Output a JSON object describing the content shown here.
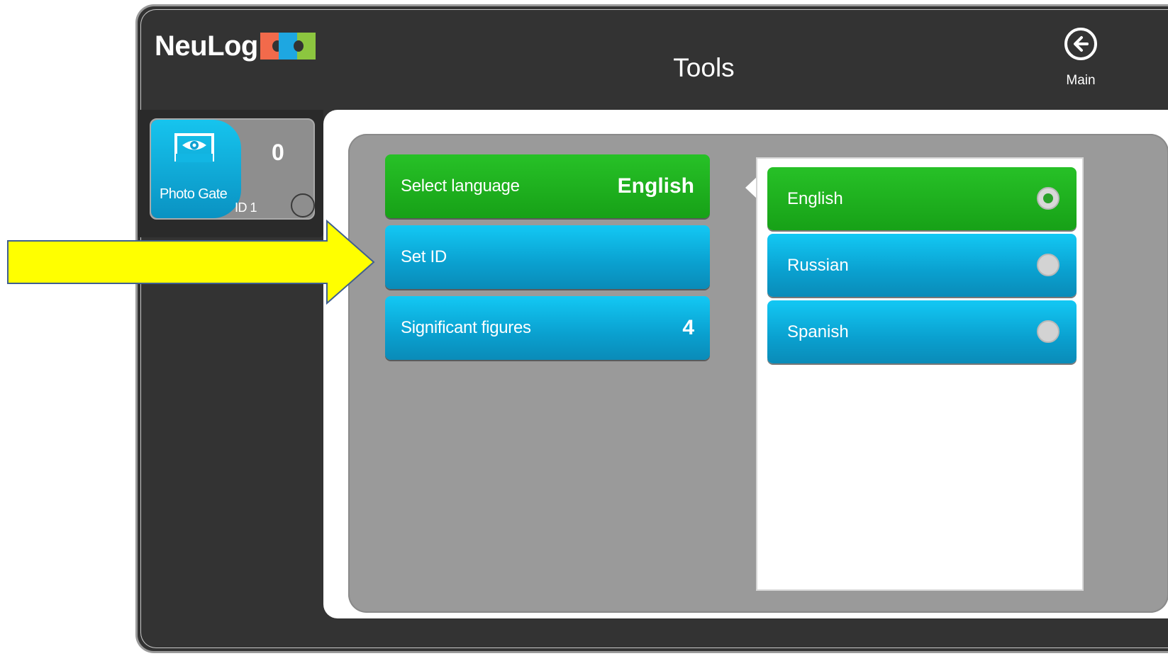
{
  "app": {
    "logo_text": "NeuLog",
    "title": "Tools",
    "main_button_label": "Main",
    "main_icon": "arrow-left-circle-icon"
  },
  "sensor": {
    "name": "Photo Gate",
    "value": "0",
    "id_label": "ID 1",
    "icon": "photo-gate-eye-icon"
  },
  "tools": {
    "items": [
      {
        "label": "Select language",
        "value": "English",
        "state": "selected"
      },
      {
        "label": "Set ID",
        "value": ""
      },
      {
        "label": "Significant figures",
        "value": "4"
      }
    ]
  },
  "languages": {
    "options": [
      {
        "label": "English",
        "selected": true
      },
      {
        "label": "Russian",
        "selected": false
      },
      {
        "label": "Spanish",
        "selected": false
      }
    ]
  },
  "colors": {
    "accent_green": "#1fae1f",
    "accent_blue": "#0fb5e6",
    "background_dark": "#333333",
    "panel_gray": "#9a9a9a",
    "annotation_arrow": "#ffff00"
  }
}
